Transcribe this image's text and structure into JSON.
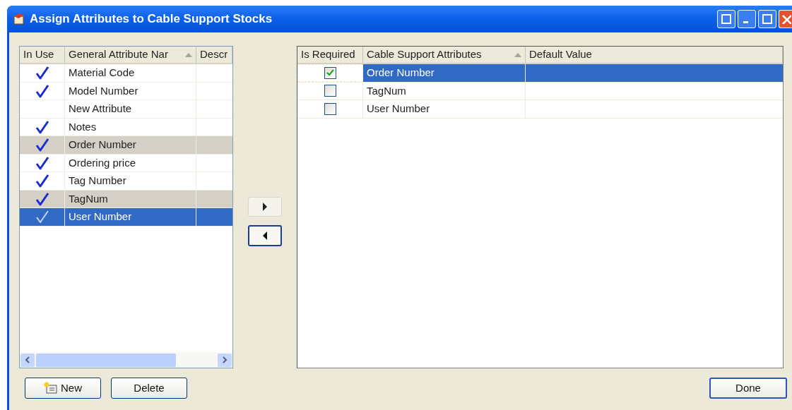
{
  "window": {
    "title": "Assign Attributes to Cable Support Stocks"
  },
  "general_attributes": {
    "columns": [
      {
        "label": "In Use",
        "sorted": false
      },
      {
        "label": "General Attribute Nar",
        "sorted": true
      },
      {
        "label": "Descr",
        "sorted": false
      }
    ],
    "rows": [
      {
        "in_use": true,
        "name": "Material Code",
        "assigned": false,
        "selected": false
      },
      {
        "in_use": true,
        "name": "Model Number",
        "assigned": false,
        "selected": false
      },
      {
        "in_use": false,
        "name": "New Attribute",
        "assigned": false,
        "selected": false
      },
      {
        "in_use": true,
        "name": "Notes",
        "assigned": false,
        "selected": false
      },
      {
        "in_use": true,
        "name": "Order Number",
        "assigned": true,
        "selected": false
      },
      {
        "in_use": true,
        "name": "Ordering price",
        "assigned": false,
        "selected": false
      },
      {
        "in_use": true,
        "name": "Tag Number",
        "assigned": false,
        "selected": false
      },
      {
        "in_use": true,
        "name": "TagNum",
        "assigned": true,
        "selected": false
      },
      {
        "in_use": true,
        "name": "User Number",
        "selected": true
      }
    ]
  },
  "cable_support_attributes": {
    "columns": [
      {
        "label": "Is Required",
        "sorted": false
      },
      {
        "label": "Cable Support Attributes",
        "sorted": true
      },
      {
        "label": "Default Value",
        "sorted": false
      }
    ],
    "rows": [
      {
        "required": true,
        "name": "Order Number",
        "selected": true
      },
      {
        "required": false,
        "name": "TagNum",
        "selected": false
      },
      {
        "required": false,
        "name": "User Number",
        "selected": false
      }
    ]
  },
  "buttons": {
    "new": "New",
    "delete": "Delete",
    "done": "Done"
  }
}
